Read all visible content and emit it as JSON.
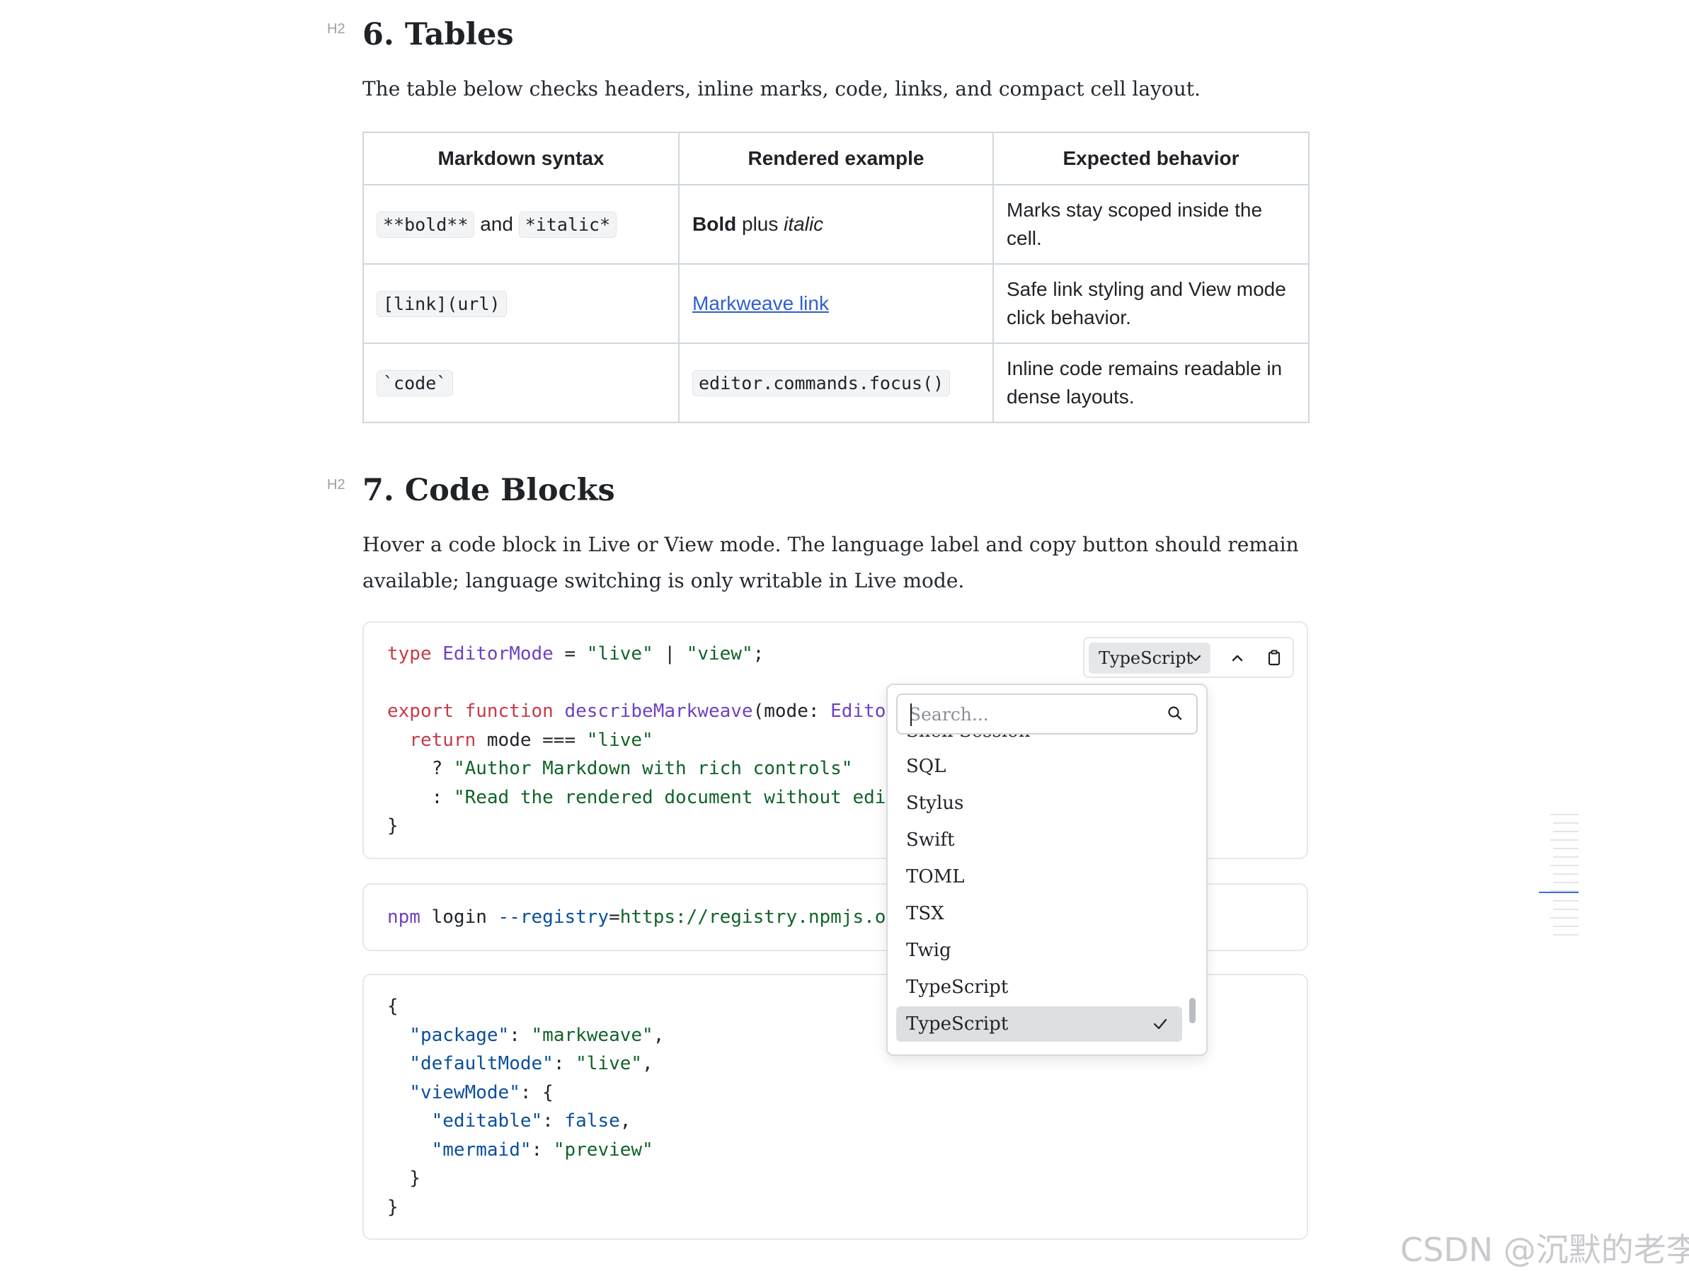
{
  "section6": {
    "label": "H2",
    "heading": "6. Tables",
    "intro": "The table below checks headers, inline marks, code, links, and compact cell layout.",
    "table": {
      "headers": [
        "Markdown syntax",
        "Rendered example",
        "Expected behavior"
      ],
      "row1": {
        "syntax_bold": "**bold**",
        "syntax_and": "and",
        "syntax_italic": "*italic*",
        "rendered_bold": "Bold",
        "rendered_plus": "plus",
        "rendered_italic": "italic",
        "behavior": "Marks stay scoped inside the cell."
      },
      "row2": {
        "syntax": "[link](url)",
        "rendered_link": "Markweave link",
        "behavior": "Safe link styling and View mode click behavior."
      },
      "row3": {
        "syntax": "`code`",
        "rendered_code": "editor.commands.focus()",
        "behavior": "Inline code remains readable in dense layouts."
      }
    }
  },
  "section7": {
    "label": "H2",
    "heading": "7. Code Blocks",
    "intro_line1": "Hover a code block in Live or View mode. The language label and copy button should remain",
    "intro_line2": "available; language switching is only writable in Live mode."
  },
  "code1": {
    "l1_kw": "type",
    "l1_ty": "EditorMode",
    "l1_eq": " = ",
    "l1_s1": "\"live\"",
    "l1_pipe": " | ",
    "l1_s2": "\"view\"",
    "l1_end": ";",
    "l3_kw": "export function",
    "l3_fn": "describeMarkweave",
    "l3_rest": "(mode: ",
    "l3_ty": "Edito",
    "l4_kw": "return",
    "l4_rest": " mode === ",
    "l4_str": "\"live\"",
    "l5_q": "? ",
    "l5_str": "\"Author Markdown with rich controls\"",
    "l6_c": ": ",
    "l6_str": "\"Read the rendered document without edi",
    "l7": "}"
  },
  "code2": {
    "cmd": "npm",
    "arg": " login ",
    "flag": "--registry",
    "eq": "=",
    "url": "https://registry.npmjs.o"
  },
  "code3": {
    "open": "{",
    "k1": "\"package\"",
    "v1": "\"markweave\"",
    "k2": "\"defaultMode\"",
    "v2": "\"live\"",
    "k3": "\"viewMode\"",
    "k4": "\"editable\"",
    "v4": "false",
    "k5": "\"mermaid\"",
    "v5": "\"preview\"",
    "close_inner": "}",
    "close": "}"
  },
  "toolbar": {
    "language": "TypeScript",
    "icons": [
      "chevron-down-icon",
      "chevron-up-icon",
      "clipboard-icon"
    ]
  },
  "dropdown": {
    "search_placeholder": "Search...",
    "partial_item": "Shell Session",
    "options": [
      "SQL",
      "Stylus",
      "Swift",
      "TOML",
      "TSX",
      "Twig",
      "TypeScript",
      "TypeScript"
    ],
    "selected_index": 7
  },
  "watermark": "CSDN @沉默的老李",
  "colors": {
    "keyword": "#c43c4a",
    "type": "#6f42c1",
    "string": "#116329",
    "json_key": "#0b4f9a",
    "link": "#2f5fd0",
    "selected_option": "#dedfe1"
  }
}
